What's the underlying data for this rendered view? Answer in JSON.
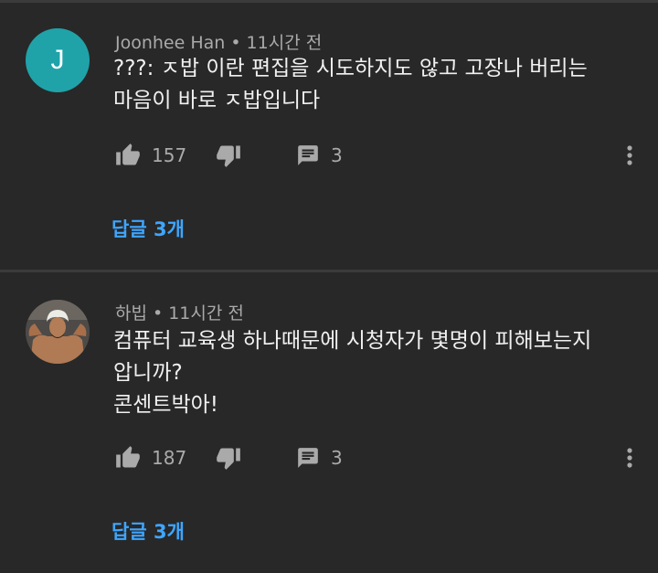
{
  "comments": [
    {
      "avatar_letter": "J",
      "author": "Joonhee Han",
      "separator": "•",
      "time": "11시간 전",
      "text": "???: ㅈ밥 이란 편집을 시도하지도 않고 고장나 버리는\n마음이 바로 ㅈ밥입니다",
      "likes": "157",
      "replies_count": "3",
      "replies_link": "답글 3개"
    },
    {
      "author": "하빕",
      "separator": "•",
      "time": "11시간 전",
      "text": "컴퓨터 교육생 하나때문에 시청자가 몇명이 피해보는지\n압니까?\n콘센트박아!",
      "likes": "187",
      "replies_count": "3",
      "replies_link": "답글 3개"
    }
  ],
  "icons": {
    "like": "thumb-up-icon",
    "dislike": "thumb-down-icon",
    "reply": "comment-icon",
    "more": "more-vertical-icon"
  },
  "colors": {
    "background": "#282828",
    "link": "#3ea6ff",
    "avatar_teal": "#1fa3a9",
    "muted_text": "#aaaaaa"
  }
}
